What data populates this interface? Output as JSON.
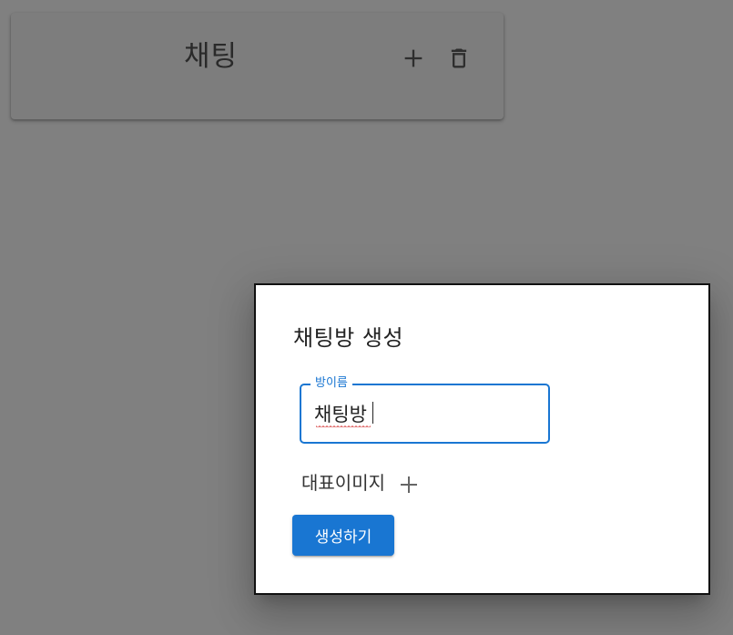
{
  "chat_header": {
    "title": "채팅",
    "add_icon": "plus-icon",
    "delete_icon": "trash-icon"
  },
  "dialog": {
    "title": "채팅방 생성",
    "room_name_field": {
      "label": "방이름",
      "value": "채팅방"
    },
    "image_section": {
      "label": "대표이미지",
      "add_icon": "plus-icon"
    },
    "create_button_label": "생성하기"
  },
  "colors": {
    "backdrop": "#808080",
    "primary": "#1976d2",
    "dialog_bg": "#ffffff"
  }
}
